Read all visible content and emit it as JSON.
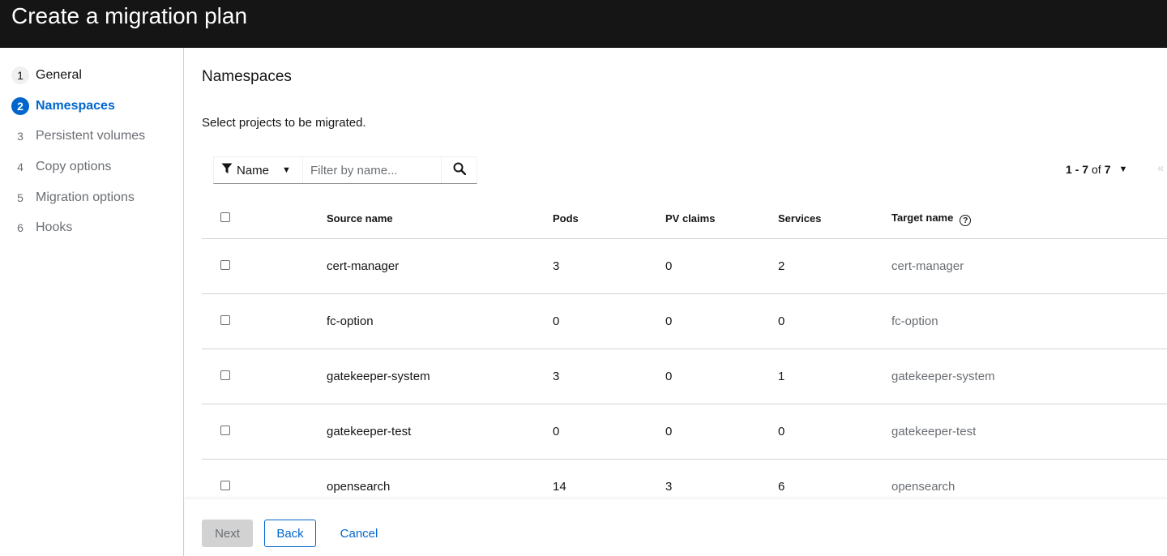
{
  "header": {
    "title": "Create a migration plan"
  },
  "wizard_steps": [
    {
      "num": "1",
      "label": "General"
    },
    {
      "num": "2",
      "label": "Namespaces"
    },
    {
      "num": "3",
      "label": "Persistent volumes"
    },
    {
      "num": "4",
      "label": "Copy options"
    },
    {
      "num": "5",
      "label": "Migration options"
    },
    {
      "num": "6",
      "label": "Hooks"
    }
  ],
  "main": {
    "title": "Namespaces",
    "description": "Select projects to be migrated.",
    "filter": {
      "attribute": "Name",
      "placeholder": "Filter by name..."
    },
    "pagination": {
      "range": "1 - 7",
      "of_label": "of",
      "total": "7"
    },
    "table": {
      "columns": [
        "Source name",
        "Pods",
        "PV claims",
        "Services",
        "Target name"
      ],
      "rows": [
        {
          "source": "cert-manager",
          "pods": "3",
          "pvc": "0",
          "services": "2",
          "target": "cert-manager"
        },
        {
          "source": "fc-option",
          "pods": "0",
          "pvc": "0",
          "services": "0",
          "target": "fc-option"
        },
        {
          "source": "gatekeeper-system",
          "pods": "3",
          "pvc": "0",
          "services": "1",
          "target": "gatekeeper-system"
        },
        {
          "source": "gatekeeper-test",
          "pods": "0",
          "pvc": "0",
          "services": "0",
          "target": "gatekeeper-test"
        },
        {
          "source": "opensearch",
          "pods": "14",
          "pvc": "3",
          "services": "6",
          "target": "opensearch"
        }
      ]
    }
  },
  "footer": {
    "next": "Next",
    "back": "Back",
    "cancel": "Cancel"
  },
  "colors": {
    "header_bg": "#151515",
    "accent": "#0066cc",
    "muted": "#6a6e73",
    "border": "#d2d2d2"
  }
}
